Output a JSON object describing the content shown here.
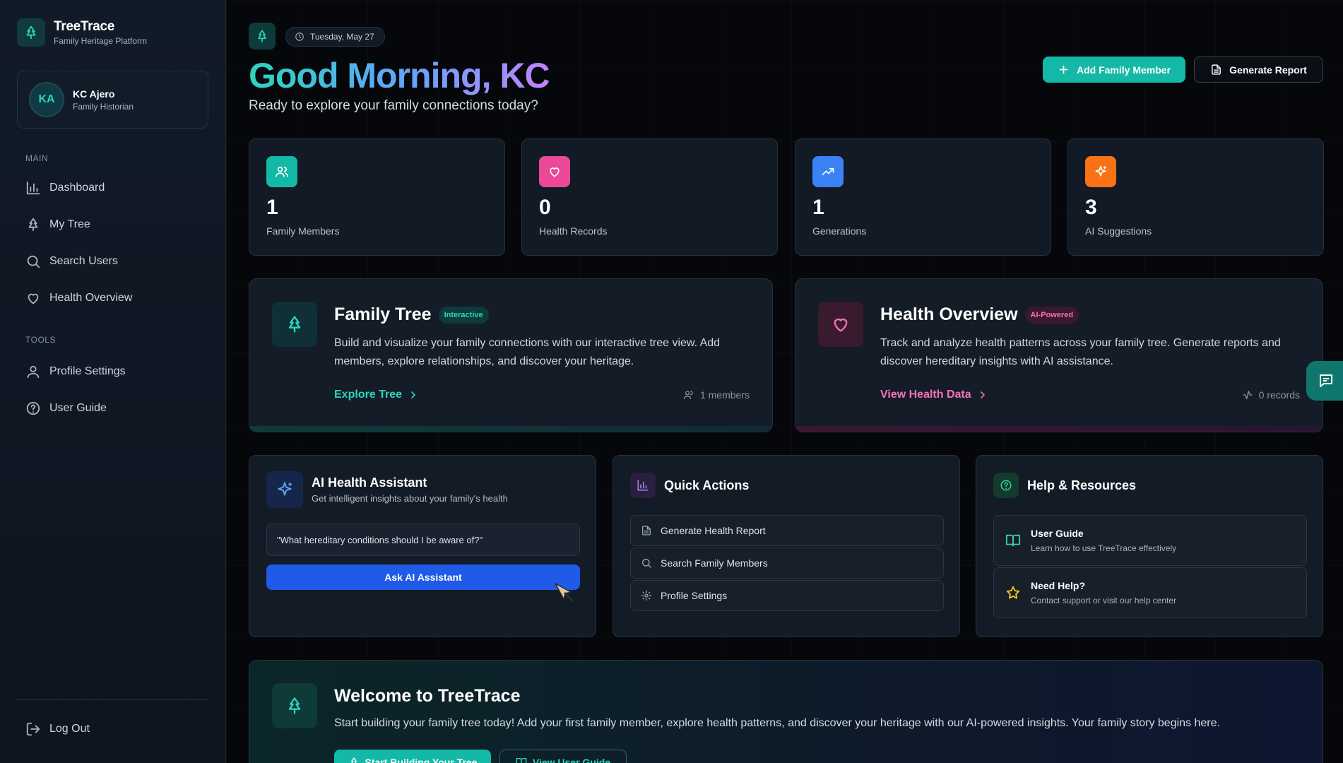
{
  "brand": {
    "name": "TreeTrace",
    "tagline": "Family Heritage Platform"
  },
  "user": {
    "initials": "KA",
    "name": "KC Ajero",
    "role": "Family Historian"
  },
  "sidebar": {
    "main_label": "MAIN",
    "main_items": [
      {
        "label": "Dashboard",
        "icon": "bar-chart-icon"
      },
      {
        "label": "My Tree",
        "icon": "tree-icon"
      },
      {
        "label": "Search Users",
        "icon": "search-icon"
      },
      {
        "label": "Health Overview",
        "icon": "heart-icon"
      }
    ],
    "tools_label": "TOOLS",
    "tools_items": [
      {
        "label": "Profile Settings",
        "icon": "user-icon"
      },
      {
        "label": "User Guide",
        "icon": "help-circle-icon"
      }
    ],
    "logout_label": "Log Out"
  },
  "header": {
    "date": "Tuesday, May 27",
    "greeting": "Good Morning, KC",
    "subtitle": "Ready to explore your family connections today?",
    "add_member_label": "Add Family Member",
    "generate_report_label": "Generate Report"
  },
  "stats": [
    {
      "value": "1",
      "label": "Family Members",
      "color": "#14b8a6",
      "icon": "users-icon"
    },
    {
      "value": "0",
      "label": "Health Records",
      "color": "#ec4899",
      "icon": "heart-icon"
    },
    {
      "value": "1",
      "label": "Generations",
      "color": "#3b82f6",
      "icon": "trending-up-icon"
    },
    {
      "value": "3",
      "label": "AI Suggestions",
      "color": "#f97316",
      "icon": "sparkles-icon"
    }
  ],
  "family_tree_card": {
    "title": "Family Tree",
    "badge": "Interactive",
    "description": "Build and visualize your family connections with our interactive tree view. Add members, explore relationships, and discover your heritage.",
    "link_label": "Explore Tree",
    "meta": "1 members"
  },
  "health_card": {
    "title": "Health Overview",
    "badge": "AI-Powered",
    "description": "Track and analyze health patterns across your family tree. Generate reports and discover hereditary insights with AI assistance.",
    "link_label": "View Health Data",
    "meta": "0 records"
  },
  "ai_assistant": {
    "title": "AI Health Assistant",
    "subtitle": "Get intelligent insights about your family's health",
    "prompt": "\"What hereditary conditions should I be aware of?\"",
    "button_label": "Ask AI Assistant"
  },
  "quick_actions": {
    "title": "Quick Actions",
    "items": [
      {
        "label": "Generate Health Report",
        "icon": "file-icon"
      },
      {
        "label": "Search Family Members",
        "icon": "search-icon"
      },
      {
        "label": "Profile Settings",
        "icon": "gear-icon"
      }
    ]
  },
  "help": {
    "title": "Help & Resources",
    "items": [
      {
        "title": "User Guide",
        "subtitle": "Learn how to use TreeTrace effectively",
        "icon": "book-icon"
      },
      {
        "title": "Need Help?",
        "subtitle": "Contact support or visit our help center",
        "icon": "star-icon"
      }
    ]
  },
  "welcome": {
    "title": "Welcome to TreeTrace",
    "description": "Start building your family tree today! Add your first family member, explore health patterns, and discover your heritage with our AI-powered insights. Your family story begins here.",
    "primary_label": "Start Building Your Tree",
    "secondary_label": "View User Guide"
  }
}
